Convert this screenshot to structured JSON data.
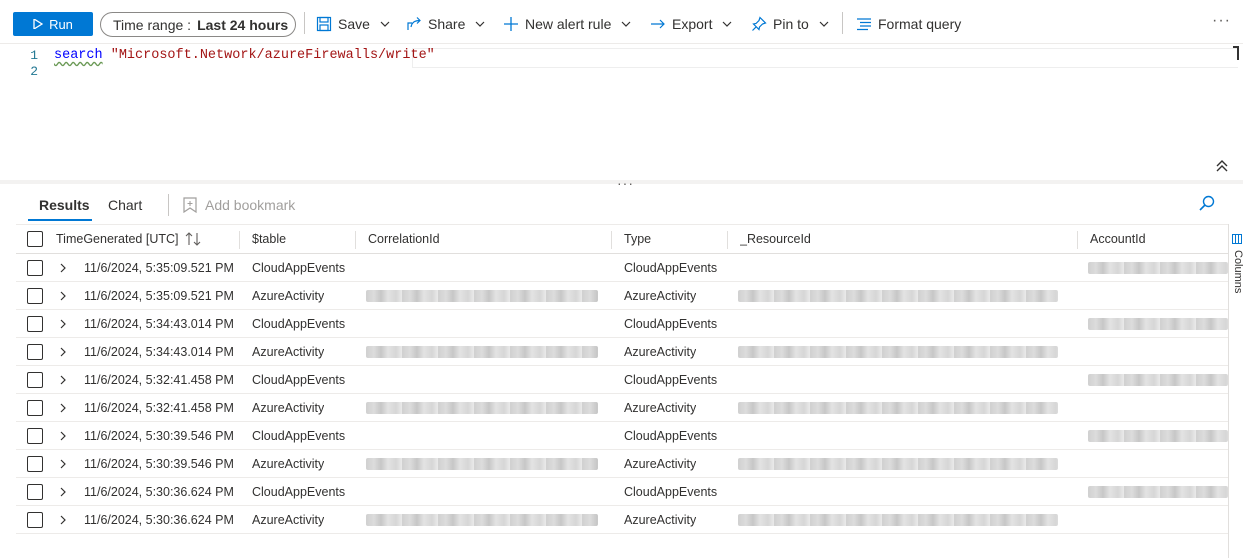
{
  "toolbar": {
    "run_label": "Run",
    "time_range_label": "Time range :",
    "time_range_value": "Last 24 hours",
    "save_label": "Save",
    "share_label": "Share",
    "new_alert_label": "New alert rule",
    "export_label": "Export",
    "pin_label": "Pin to",
    "format_label": "Format query",
    "more_label": "···"
  },
  "editor": {
    "line1_no": "1",
    "line2_no": "2",
    "keyword": "search",
    "string": "\"Microsoft.Network/azureFirewalls/write\""
  },
  "results": {
    "tab_results": "Results",
    "tab_chart": "Chart",
    "add_bookmark": "Add bookmark",
    "columns_label": "Columns",
    "headers": {
      "time": "TimeGenerated [UTC]",
      "table": "$table",
      "correlation": "CorrelationId",
      "type": "Type",
      "resource": "_ResourceId",
      "account": "AccountId"
    },
    "rows": [
      {
        "time": "11/6/2024, 5:35:09.521 PM",
        "table": "CloudAppEvents",
        "type": "CloudAppEvents"
      },
      {
        "time": "11/6/2024, 5:35:09.521 PM",
        "table": "AzureActivity",
        "type": "AzureActivity"
      },
      {
        "time": "11/6/2024, 5:34:43.014 PM",
        "table": "CloudAppEvents",
        "type": "CloudAppEvents"
      },
      {
        "time": "11/6/2024, 5:34:43.014 PM",
        "table": "AzureActivity",
        "type": "AzureActivity"
      },
      {
        "time": "11/6/2024, 5:32:41.458 PM",
        "table": "CloudAppEvents",
        "type": "CloudAppEvents"
      },
      {
        "time": "11/6/2024, 5:32:41.458 PM",
        "table": "AzureActivity",
        "type": "AzureActivity"
      },
      {
        "time": "11/6/2024, 5:30:39.546 PM",
        "table": "CloudAppEvents",
        "type": "CloudAppEvents"
      },
      {
        "time": "11/6/2024, 5:30:39.546 PM",
        "table": "AzureActivity",
        "type": "AzureActivity"
      },
      {
        "time": "11/6/2024, 5:30:36.624 PM",
        "table": "CloudAppEvents",
        "type": "CloudAppEvents"
      },
      {
        "time": "11/6/2024, 5:30:36.624 PM",
        "table": "AzureActivity",
        "type": "AzureActivity"
      }
    ]
  },
  "colors": {
    "accent": "#0078d4",
    "keyword": "#0000ff",
    "string": "#a31515"
  }
}
